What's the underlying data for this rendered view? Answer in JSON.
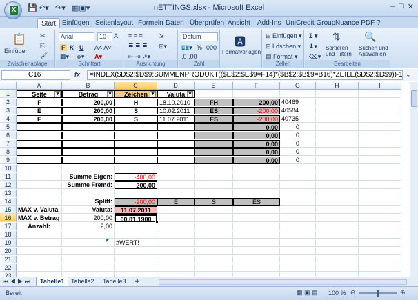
{
  "window": {
    "title": "nETTINGS.xlsx - Microsoft Excel",
    "min": "–",
    "max": "□",
    "close": "✕",
    "app_initial": "X"
  },
  "tabs": [
    "Start",
    "Einfügen",
    "Seitenlayout",
    "Formeln",
    "Daten",
    "Überprüfen",
    "Ansicht",
    "Add-Ins",
    "UniCredit Group",
    "Nuance PDF"
  ],
  "ribbon": {
    "clipboard": {
      "paste": "Einfügen",
      "label": "Zwischenablage"
    },
    "font": {
      "name": "Arial",
      "size": "10",
      "label": "Schriftart",
      "bold": "F",
      "italic": "K",
      "underline": "U"
    },
    "align": {
      "label": "Ausrichtung"
    },
    "number": {
      "format": "Datum",
      "percent": "%",
      "thousands": "000",
      "label": "Zahl"
    },
    "styles": {
      "format_templates": "Formatvorlagen"
    },
    "cells": {
      "insert": "Einfügen",
      "delete": "Löschen",
      "format": "Format",
      "label": "Zellen"
    },
    "edit": {
      "sum": "Σ",
      "sort": "Sortieren\nund Filtern",
      "find": "Suchen und\nAuswählen",
      "label": "Bearbeiten"
    }
  },
  "formula_bar": {
    "name_box": "C16",
    "fx": "fx",
    "formula": "=INDEX($D$2:$D$9;SUMMENPRODUKT(($E$2:$E$9=F14)*($B$2:$B$9=B16)*ZEILE($D$2:$D$9))-1)"
  },
  "columns": [
    "A",
    "B",
    "C",
    "D",
    "E",
    "F",
    "G",
    "H",
    "I"
  ],
  "rows": [
    "1",
    "2",
    "3",
    "4",
    "5",
    "6",
    "7",
    "8",
    "9",
    "10",
    "11",
    "12",
    "13",
    "14",
    "15",
    "16",
    "17",
    "18",
    "19",
    "20",
    "21",
    "22",
    "23"
  ],
  "cells": {
    "A1": "Seite",
    "B1": "Betrag",
    "C1": "Zeichen",
    "D1": "Valuta",
    "A2": "F",
    "B2": "200,00",
    "C2": "H",
    "D2": "18.10.2010",
    "E2": "FH",
    "F2": "200,00",
    "G2": "40469",
    "A3": "E",
    "B3": "200,00",
    "C3": "S",
    "D3": "10.02.2011",
    "E3": "ES",
    "F3": "-200,00",
    "G3": "40584",
    "A4": "E",
    "B4": "200,00",
    "C4": "S",
    "D4": "11.07.2011",
    "E4": "ES",
    "F4": "-200,00",
    "G4": "40735",
    "F5": "0,00",
    "G5": "0",
    "F6": "0,00",
    "G6": "0",
    "F7": "0,00",
    "G7": "0",
    "F8": "0,00",
    "G8": "0",
    "F9": "0,00",
    "G9": "0",
    "B11": "Summe Eigen:",
    "C11": "-400,00",
    "B12": "Summe Fremd:",
    "C12": "200,00",
    "B14": "Splitt:",
    "C14": "-200,00",
    "D14": "E",
    "E14": "S",
    "F14": "ES",
    "A15": "MAX v. Valuta",
    "B15": "Valuta:",
    "C15": "11.07.2011",
    "A16": "MAX v. Betrag",
    "B16": "200,00",
    "C16": "00.01.1900",
    "A17": "Anzahl:",
    "B17": "2,00",
    "C19": "#WERT!"
  },
  "sheets": [
    "Tabelle1",
    "Tabelle2",
    "Tabelle3"
  ],
  "status": {
    "ready": "Bereit",
    "zoom": "100 %"
  },
  "colors": {
    "accent": "#c4d8ef",
    "negative": "#ff0000",
    "grey_fill": "#c0c0c0",
    "pink_fill": "#f4b8b8",
    "orange_sel": "#ffc95a"
  }
}
